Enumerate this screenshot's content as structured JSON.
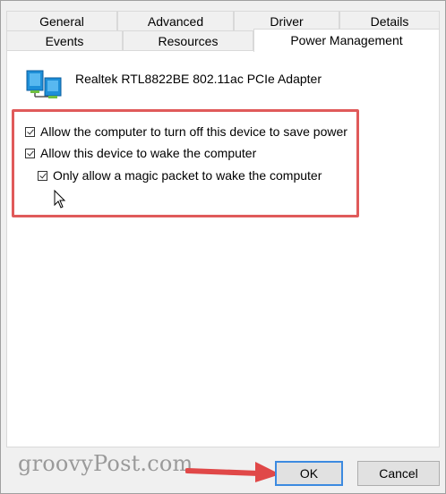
{
  "tabs": {
    "row1": [
      "General",
      "Advanced",
      "Driver",
      "Details"
    ],
    "row2": [
      "Events",
      "Resources",
      "Power Management"
    ]
  },
  "device": {
    "name": "Realtek RTL8822BE 802.11ac PCIe Adapter",
    "icon": "network-adapter-icon"
  },
  "options": {
    "allow_turn_off": {
      "label": "Allow the computer to turn off this device to save power",
      "checked": true
    },
    "allow_wake": {
      "label": "Allow this device to wake the computer",
      "checked": true
    },
    "magic_packet": {
      "label": "Only allow a magic packet to wake the computer",
      "checked": true
    }
  },
  "buttons": {
    "ok": "OK",
    "cancel": "Cancel"
  },
  "watermark": "groovyPost.com",
  "colors": {
    "highlight": "#e05a5a",
    "arrow": "#e04848",
    "focus": "#3c8ae0"
  }
}
